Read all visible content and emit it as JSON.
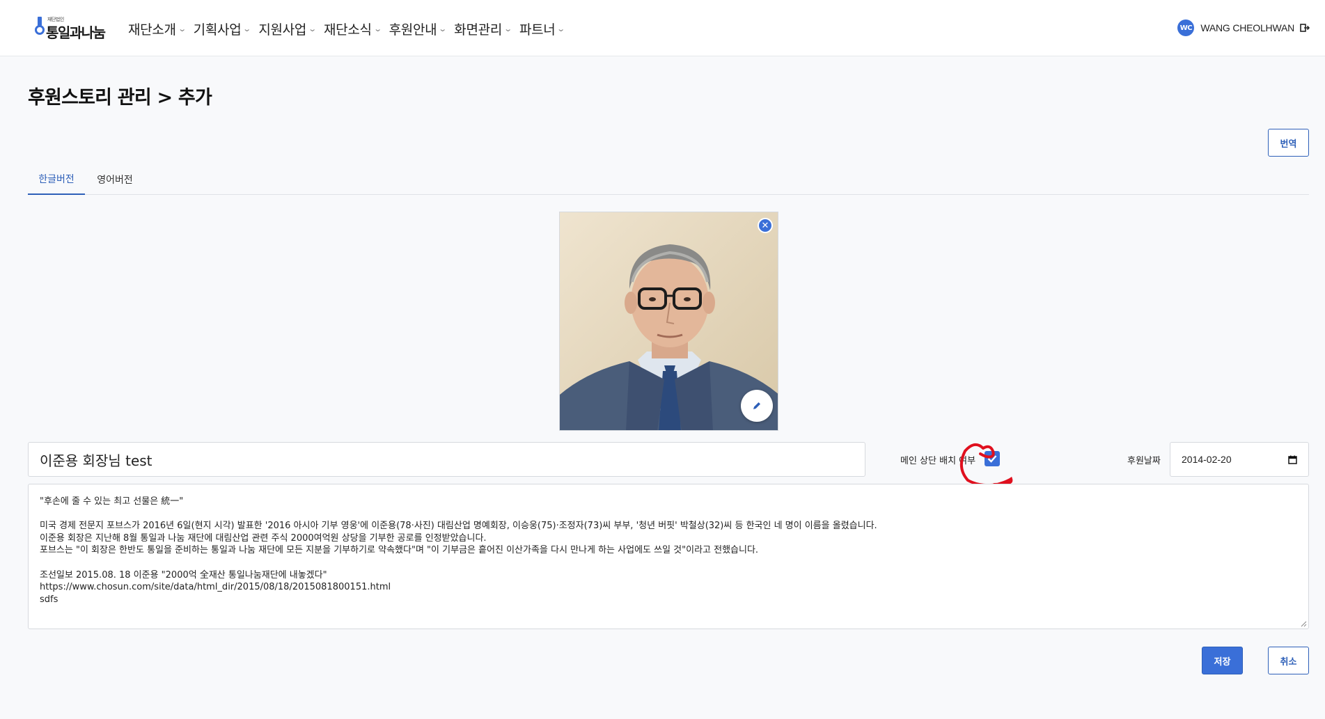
{
  "header": {
    "logo_sub": "재단법인",
    "logo_main": "통일과나눔",
    "nav": [
      {
        "label": "재단소개"
      },
      {
        "label": "기획사업"
      },
      {
        "label": "지원사업"
      },
      {
        "label": "재단소식"
      },
      {
        "label": "후원안내"
      },
      {
        "label": "화면관리"
      },
      {
        "label": "파트너"
      }
    ],
    "user": {
      "initials": "WC",
      "name": "WANG CHEOLHWAN"
    }
  },
  "page": {
    "title": "후원스토리 관리 > 추가",
    "translate_button": "번역",
    "tabs": [
      {
        "label": "한글버전",
        "active": true
      },
      {
        "label": "영어버전",
        "active": false
      }
    ]
  },
  "form": {
    "title_value": "이준용 회장님 test",
    "main_top_label": "메인 상단 배치 여부",
    "main_top_checked": true,
    "date_label": "후원날짜",
    "date_value": "2014-02-20",
    "body_lines": [
      "\"후손에 줄 수 있는 최고 선물은 統一\"",
      "",
      "미국 경제 전문지 포브스가 2016년 6일(현지 시각) 발표한 '2016 아시아 기부 영웅'에 이준용(78·사진) 대림산업 명예회장, 이승웅(75)·조정자(73)씨 부부, '청년 버핏' 박철상(32)씨 등 한국인 네 명이 이름을 올렸습니다.",
      "이준용 회장은 지난해 8월 통일과 나눔 재단에 대림산업 관련 주식 2000여억원 상당을 기부한 공로를 인정받았습니다.",
      "포브스는 \"이 회장은 한반도 통일을 준비하는 통일과 나눔 재단에 모든 지분을 기부하기로 약속했다\"며 \"이 기부금은 흩어진 이산가족을 다시 만나게 하는 사업에도 쓰일 것\"이라고 전했습니다.",
      "",
      "조선일보 2015.08. 18 이준용 \"2000억 全재산 통일나눔재단에 내놓겠다\"",
      "https://www.chosun.com/site/data/html_dir/2015/08/18/2015081800151.html",
      "sdfs"
    ]
  },
  "actions": {
    "save": "저장",
    "cancel": "취소"
  },
  "colors": {
    "accent": "#3a6fd8",
    "accent_dark": "#2d5fb8",
    "annotation": "#e0101e"
  }
}
